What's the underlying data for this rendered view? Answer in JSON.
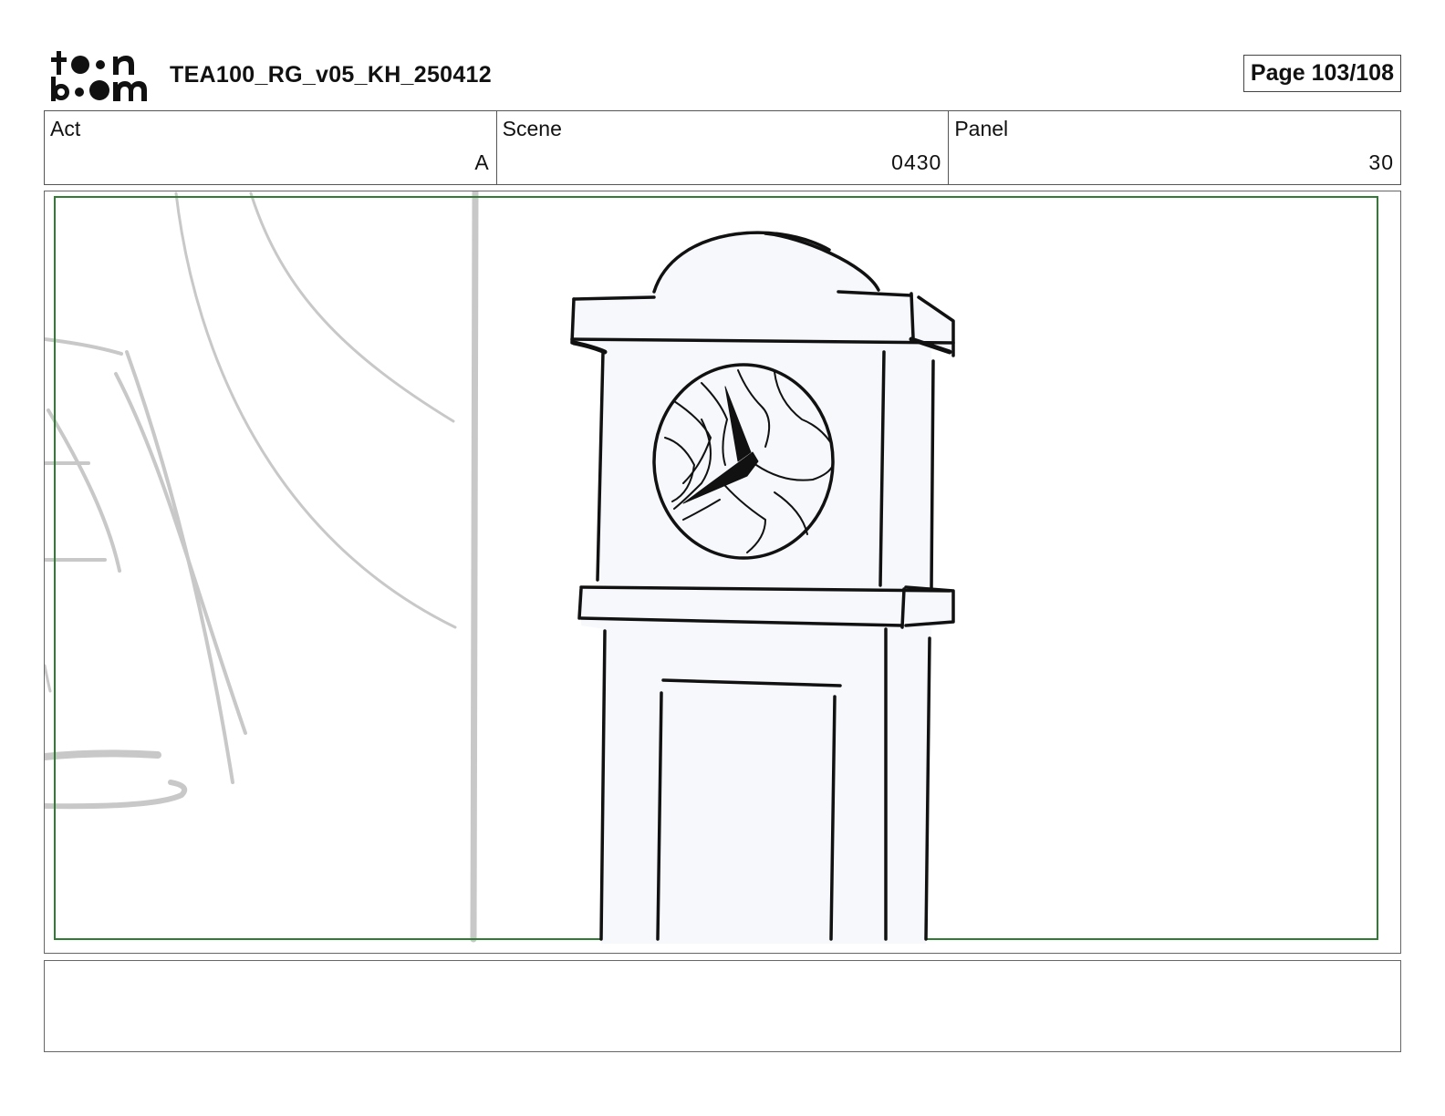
{
  "header": {
    "logo_text": "toon boom",
    "doc_title": "TEA100_RG_v05_KH_250412",
    "page_label": "Page 103/108"
  },
  "meta": {
    "act": {
      "label": "Act",
      "value": "A"
    },
    "scene": {
      "label": "Scene",
      "value": "0430"
    },
    "panel": {
      "label": "Panel",
      "value": "30"
    }
  },
  "panel_image": {
    "icon": "grandfather-clock-sketch",
    "frame_color": "#2e7d32",
    "background_sketch_color": "#c8c8c8",
    "clock_fill": "#f6f8fc"
  },
  "notes": {
    "text": ""
  }
}
